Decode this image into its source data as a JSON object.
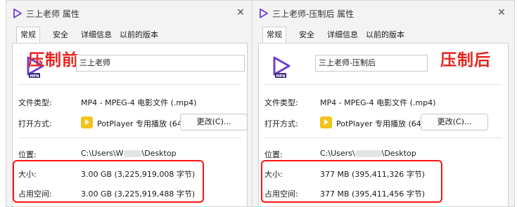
{
  "left_window": {
    "title": "三上老师 属性",
    "tabs": [
      "常规",
      "安全",
      "详细信息",
      "以前的版本"
    ],
    "file_name": "三上老师",
    "file_type_label": "文件类型:",
    "file_type_value": "MP4 - MPEG-4 电影文件 (.mp4)",
    "open_with_label": "打开方式:",
    "open_with_value": "PotPlayer 专用播放 (64",
    "change_button": "更改(C)...",
    "location_label": "位置:",
    "location_prefix": "C:\\Users\\",
    "location_mid": "W",
    "location_suffix": "\\Desktop",
    "size_label": "大小:",
    "size_value": "3.00 GB (3,225,919,008 字节)",
    "disk_size_label": "占用空间:",
    "disk_size_value": "3.00 GB (3,225,919,488 字节)",
    "annotation": "压制前"
  },
  "right_window": {
    "title": "三上老师-压制后 属性",
    "tabs": [
      "常规",
      "安全",
      "详细信息",
      "以前的版本"
    ],
    "file_name": "三上老师-压制后",
    "file_type_label": "文件类型:",
    "file_type_value": "MP4 - MPEG-4 电影文件 (.mp4)",
    "open_with_label": "打开方式:",
    "open_with_value": "PotPlayer 专用播放 (64",
    "change_button": "更改(C)...",
    "location_label": "位置:",
    "location_prefix": "C:\\Users\\",
    "location_suffix": "\\Desktop",
    "size_label": "大小:",
    "size_value": "377 MB (395,411,326 字节)",
    "disk_size_label": "占用空间:",
    "disk_size_value": "377 MB (395,411,456 字节)",
    "annotation": "压制后"
  },
  "icons": {
    "file_icon_badge": "MPN",
    "close": "close-icon",
    "player": "potplayer-icon"
  },
  "colors": {
    "annotation_red": "#e6241f",
    "highlight_box": "#ff1212",
    "video_icon_purple": "#6d3fd6"
  }
}
